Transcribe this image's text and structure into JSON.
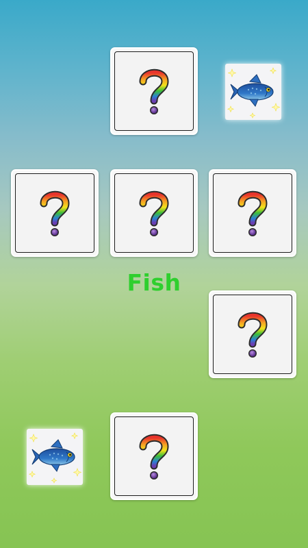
{
  "game": {
    "word": "Fish",
    "word_color": "#2ecf2e"
  },
  "cards": [
    {
      "state": "hidden",
      "icon": "question-mark-icon"
    },
    {
      "state": "revealed",
      "icon": "fish-icon"
    },
    {
      "state": "hidden",
      "icon": "question-mark-icon"
    },
    {
      "state": "hidden",
      "icon": "question-mark-icon"
    },
    {
      "state": "hidden",
      "icon": "question-mark-icon"
    },
    {
      "state": "hidden",
      "icon": "question-mark-icon"
    },
    {
      "state": "revealed",
      "icon": "fish-icon"
    },
    {
      "state": "hidden",
      "icon": "question-mark-icon"
    }
  ]
}
